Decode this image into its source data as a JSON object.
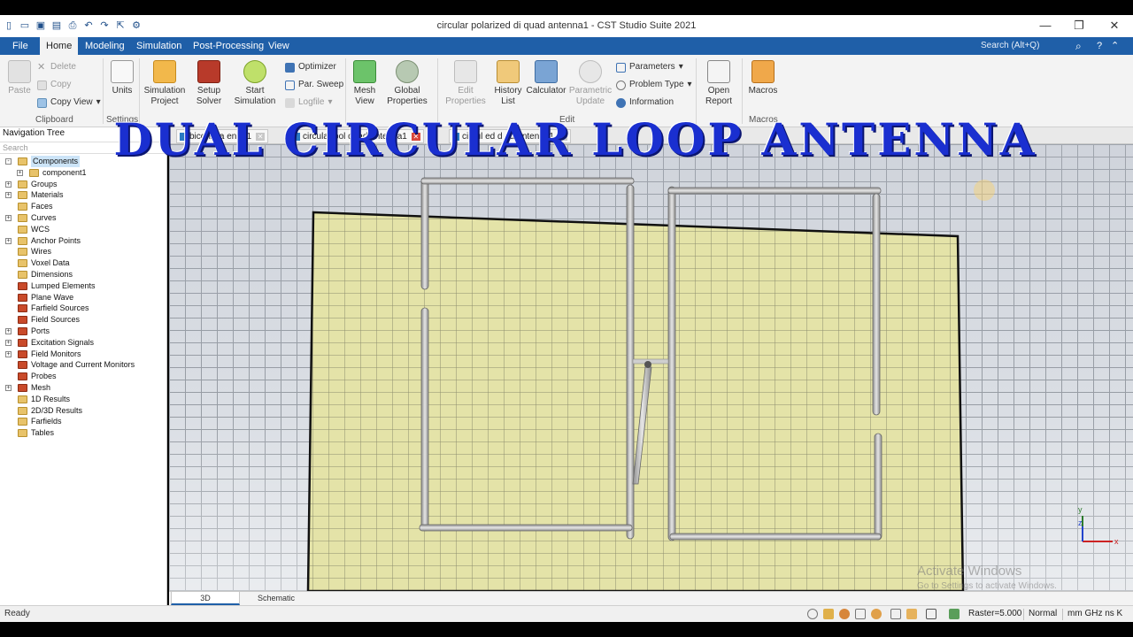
{
  "window": {
    "title": "circular polarized di quad antenna1 - CST Studio Suite 2021",
    "min_label": "—",
    "restore_label": "❐",
    "close_label": "✕"
  },
  "menu": {
    "items": [
      "File",
      "Home",
      "Modeling",
      "Simulation",
      "Post-Processing",
      "View"
    ],
    "active": "Home",
    "search_placeholder": "Search (Alt+Q)"
  },
  "ribbon": {
    "clipboard": {
      "paste": "Paste",
      "delete": "Delete",
      "copy": "Copy",
      "copy_view": "Copy View",
      "label": "Clipboard"
    },
    "settings": {
      "units": "Units",
      "label": "Settings"
    },
    "simulation": {
      "project": "Simulation Project",
      "setup": "Setup Solver",
      "start": "Start Simulation",
      "optimizer": "Optimizer",
      "par_sweep": "Par. Sweep",
      "logfile": "Logfile",
      "label": "Simulation"
    },
    "mesh": {
      "view": "Mesh View",
      "global": "Global Properties",
      "label": "Mesh"
    },
    "edit": {
      "edit_props": "Edit Properties",
      "history": "History List",
      "calculator": "Calculator",
      "param_update": "Parametric Update",
      "parameters": "Parameters",
      "problem_type": "Problem Type",
      "information": "Information",
      "label": "Edit"
    },
    "report": {
      "open": "Open Report",
      "label": "Report"
    },
    "macros": {
      "macros": "Macros",
      "label": "Macros"
    }
  },
  "nav": {
    "title": "Navigation Tree",
    "search_placeholder": "Search",
    "items": [
      {
        "label": "Components",
        "expander": "-",
        "selected": true,
        "icon": "folder"
      },
      {
        "label": "component1",
        "expander": "+",
        "indent": 1,
        "icon": "component"
      },
      {
        "label": "Groups",
        "expander": "+",
        "icon": "folder"
      },
      {
        "label": "Materials",
        "expander": "+",
        "icon": "folder"
      },
      {
        "label": "Faces",
        "icon": "folder"
      },
      {
        "label": "Curves",
        "expander": "+",
        "icon": "folder"
      },
      {
        "label": "WCS",
        "icon": "folder"
      },
      {
        "label": "Anchor Points",
        "expander": "+",
        "icon": "folder"
      },
      {
        "label": "Wires",
        "icon": "folder"
      },
      {
        "label": "Voxel Data",
        "icon": "folder"
      },
      {
        "label": "Dimensions",
        "icon": "folder"
      },
      {
        "label": "Lumped Elements",
        "icon": "red"
      },
      {
        "label": "Plane Wave",
        "icon": "red"
      },
      {
        "label": "Farfield Sources",
        "icon": "red"
      },
      {
        "label": "Field Sources",
        "icon": "red"
      },
      {
        "label": "Ports",
        "expander": "+",
        "icon": "red"
      },
      {
        "label": "Excitation Signals",
        "expander": "+",
        "icon": "red"
      },
      {
        "label": "Field Monitors",
        "expander": "+",
        "icon": "red"
      },
      {
        "label": "Voltage and Current Monitors",
        "icon": "red"
      },
      {
        "label": "Probes",
        "icon": "red"
      },
      {
        "label": "Mesh",
        "expander": "+",
        "icon": "red"
      },
      {
        "label": "1D Results",
        "icon": "folder"
      },
      {
        "label": "2D/3D Results",
        "icon": "folder"
      },
      {
        "label": "Farfields",
        "icon": "folder"
      },
      {
        "label": "Tables",
        "icon": "folder"
      }
    ]
  },
  "doc_tabs": [
    {
      "label": "biconic a  enna1"
    },
    {
      "label": "circular pol   quad antenna1"
    },
    {
      "label": "circul   ed d   ad antenna1"
    }
  ],
  "banner": "DUAL CIRCULAR  LOOP ANTENNA",
  "bottom_tabs": [
    "3D",
    "Schematic"
  ],
  "status": {
    "text": "Ready",
    "raster": "Raster=5.000",
    "mode": "Normal",
    "units": "mm  GHz  ns  K"
  },
  "watermark": {
    "title": "Activate Windows",
    "sub": "Go to Settings to activate Windows."
  },
  "axes": {
    "x": "x",
    "y": "y",
    "z": "z"
  }
}
